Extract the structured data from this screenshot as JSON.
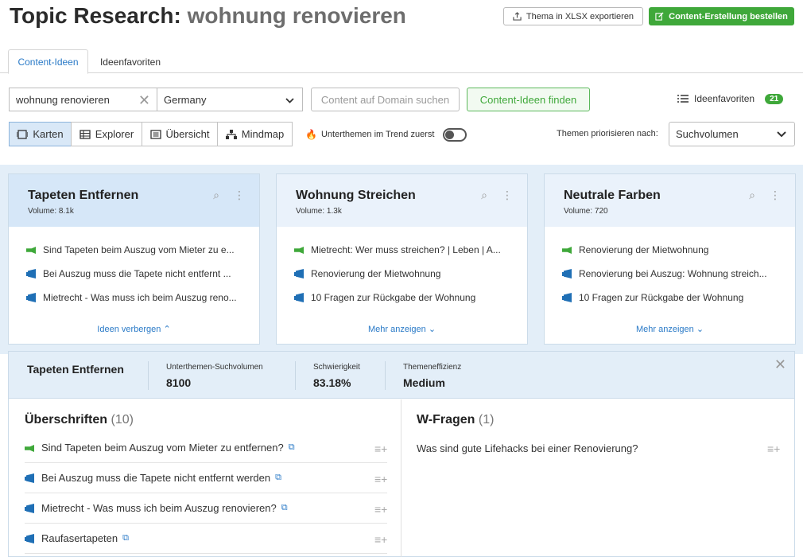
{
  "header": {
    "title_prefix": "Topic Research:",
    "keyword": "wohnung renovieren",
    "export_label": "Thema in XLSX exportieren",
    "order_label": "Content-Erstellung bestellen"
  },
  "tabs": [
    {
      "label": "Content-Ideen",
      "active": true
    },
    {
      "label": "Ideenfavoriten",
      "active": false
    }
  ],
  "search": {
    "keyword_value": "wohnung renovieren",
    "country_value": "Germany",
    "domain_placeholder": "Content auf Domain suchen",
    "find_label": "Content-Ideen finden",
    "favorites_label": "Ideenfavoriten",
    "favorites_count": "21"
  },
  "views": {
    "items": [
      {
        "label": "Karten",
        "icon": "cards-icon",
        "active": true
      },
      {
        "label": "Explorer",
        "icon": "table-icon",
        "active": false
      },
      {
        "label": "Übersicht",
        "icon": "overview-icon",
        "active": false
      },
      {
        "label": "Mindmap",
        "icon": "mindmap-icon",
        "active": false
      }
    ],
    "trend_label": "Unterthemen im Trend zuerst",
    "prioritize_label": "Themen priorisieren nach:",
    "prioritize_value": "Suchvolumen"
  },
  "cards": [
    {
      "title": "Tapeten Entfernen",
      "volume": "Volume:  8.1k",
      "items": [
        {
          "type": "green",
          "text": "Sind Tapeten beim Auszug vom Mieter zu e..."
        },
        {
          "type": "blue",
          "text": "Bei Auszug muss die Tapete nicht entfernt ..."
        },
        {
          "type": "blue",
          "text": "Mietrecht - Was muss ich beim Auszug reno..."
        }
      ],
      "toggle_label": "Ideen verbergen"
    },
    {
      "title": "Wohnung Streichen",
      "volume": "Volume:  1.3k",
      "items": [
        {
          "type": "green",
          "text": "Mietrecht: Wer muss streichen? | Leben | A..."
        },
        {
          "type": "blue",
          "text": "Renovierung der Mietwohnung"
        },
        {
          "type": "blue",
          "text": "10 Fragen zur Rückgabe der Wohnung"
        }
      ],
      "toggle_label": "Mehr anzeigen"
    },
    {
      "title": "Neutrale Farben",
      "volume": "Volume:  720",
      "items": [
        {
          "type": "green",
          "text": "Renovierung der Mietwohnung"
        },
        {
          "type": "blue",
          "text": "Renovierung bei Auszug: Wohnung streich..."
        },
        {
          "type": "blue",
          "text": "10 Fragen zur Rückgabe der Wohnung"
        }
      ],
      "toggle_label": "Mehr anzeigen"
    }
  ],
  "detail": {
    "topic": "Tapeten Entfernen",
    "metrics": [
      {
        "label": "Unterthemen-Suchvolumen",
        "value": "8100"
      },
      {
        "label": "Schwierigkeit",
        "value": "83.18%"
      },
      {
        "label": "Themeneffizienz",
        "value": "Medium"
      }
    ],
    "headings_title": "Überschriften",
    "headings_count": "(10)",
    "headings": [
      {
        "type": "green",
        "text": "Sind Tapeten beim Auszug vom Mieter zu entfernen?"
      },
      {
        "type": "blue",
        "text": "Bei Auszug muss die Tapete nicht entfernt werden"
      },
      {
        "type": "blue",
        "text": "Mietrecht - Was muss ich beim Auszug renovieren?"
      },
      {
        "type": "blue",
        "text": "Raufasertapeten"
      }
    ],
    "questions_title": "W-Fragen",
    "questions_count": "(1)",
    "questions": [
      {
        "text": "Was sind gute Lifehacks bei einer Renovierung?"
      }
    ]
  },
  "colors": {
    "accent_blue": "#2a7ac7",
    "accent_green": "#3fa83a",
    "card_bg": "#e3eef8"
  }
}
